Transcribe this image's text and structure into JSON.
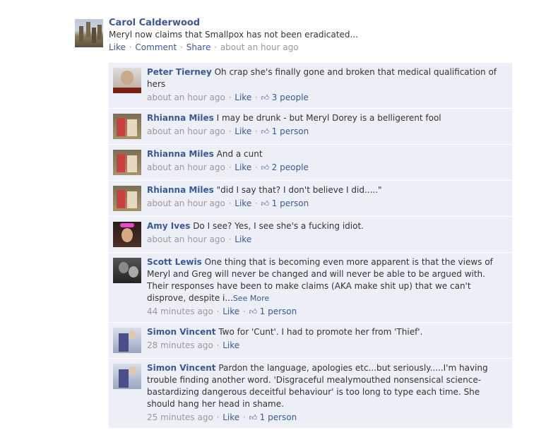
{
  "post": {
    "author": "Carol Calderwood",
    "message": "Meryl now claims that Smallpox has not been eradicated...",
    "like": "Like",
    "comment": "Comment",
    "share": "Share",
    "time": "about an hour ago"
  },
  "comments": [
    {
      "name": "Peter Tierney",
      "text": "Oh crap she's finally gone and broken that medical qualification of hers",
      "time": "about an hour ago",
      "like": "Like",
      "likes": "3 people",
      "avatar": "peter"
    },
    {
      "name": "Rhianna Miles",
      "text": "I may be drunk - but Meryl Dorey is a belligerent fool",
      "time": "about an hour ago",
      "like": "Like",
      "likes": "1 person",
      "avatar": "rhianna"
    },
    {
      "name": "Rhianna Miles",
      "text": "And a cunt",
      "time": "about an hour ago",
      "like": "Like",
      "likes": "2 people",
      "avatar": "rhianna"
    },
    {
      "name": "Rhianna Miles",
      "text": "\"did I say that? I don't believe I did.....\"",
      "time": "about an hour ago",
      "like": "Like",
      "likes": "1 person",
      "avatar": "rhianna"
    },
    {
      "name": "Amy Ives",
      "text": "Do I see? Yes, I see she's a fucking idiot.",
      "time": "about an hour ago",
      "like": "Like",
      "likes": "",
      "avatar": "amy"
    },
    {
      "name": "Scott Lewis",
      "text": "One thing that is becoming even more apparent is that the views of Meryl and Greg will never be changed and will never be able to be argued with. Their responses have been to make claims (AKA make shit up) that we can't disprove, despite i...",
      "see_more": "See More",
      "time": "44 minutes ago",
      "like": "Like",
      "likes": "1 person",
      "avatar": "scott"
    },
    {
      "name": "Simon Vincent",
      "text": "Two for 'Cunt'. I had to promote her from 'Thief'.",
      "time": "28 minutes ago",
      "like": "Like",
      "likes": "",
      "avatar": "simon"
    },
    {
      "name": "Simon Vincent",
      "text": "Pardon the language, apologies etc...but seriously.....I'm having trouble finding another word. 'Disgraceful mealymouthed nonsensical science-bastardizing dangerous deceitful behaviour' is too long to type each time. She should hang her head in shame.",
      "time": "25 minutes ago",
      "like": "Like",
      "likes": "1 person",
      "avatar": "simon"
    }
  ],
  "icons": {
    "thumb": "thumbs-up-icon"
  }
}
